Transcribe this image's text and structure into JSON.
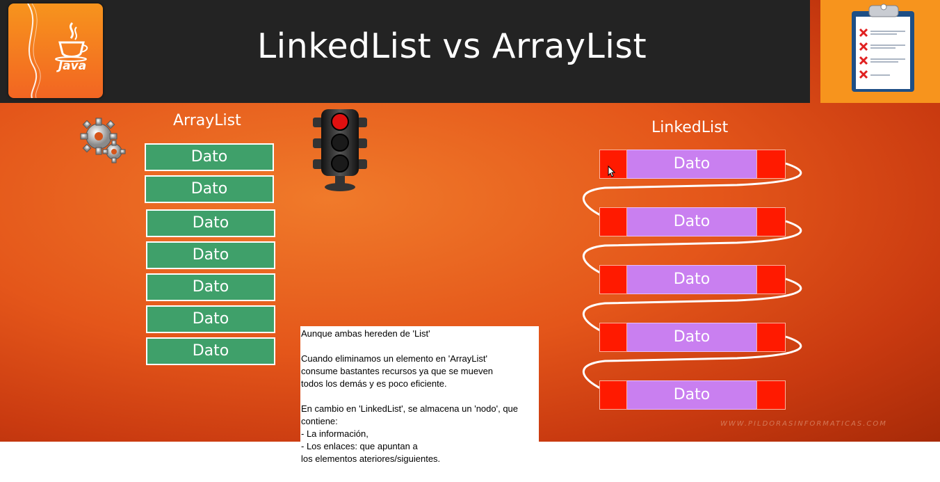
{
  "slide": {
    "title": "LinkedList vs ArrayList",
    "java_logo_text": "Java",
    "arraylist": {
      "label": "ArrayList",
      "items": [
        "Dato",
        "Dato",
        "Dato",
        "Dato",
        "Dato",
        "Dato",
        "Dato"
      ]
    },
    "linkedlist": {
      "label": "LinkedList",
      "nodes": [
        "Dato",
        "Dato",
        "Dato",
        "Dato",
        "Dato"
      ]
    },
    "watermark": "WWW.PILDORASINFORMATICAS.COM",
    "colors": {
      "header": "#232323",
      "arraylist_box": "#3fa06a",
      "node_pointer": "#ff1a00",
      "node_data": "#c97ff0",
      "accent": "#f7941d"
    }
  },
  "note": {
    "lines": [
      "Aunque ambas hereden de 'List'",
      "",
      "Cuando eliminamos  un elemento en 'ArrayList'",
      "consume bastantes recursos ya que se mueven",
      "todos los demás y es poco eficiente.",
      "",
      "En cambio en 'LinkedList', se almacena un 'nodo', que",
      "contiene:",
      "- La información,",
      "- Los enlaces: que apuntan a",
      "los elementos ateriores/siguientes."
    ]
  }
}
